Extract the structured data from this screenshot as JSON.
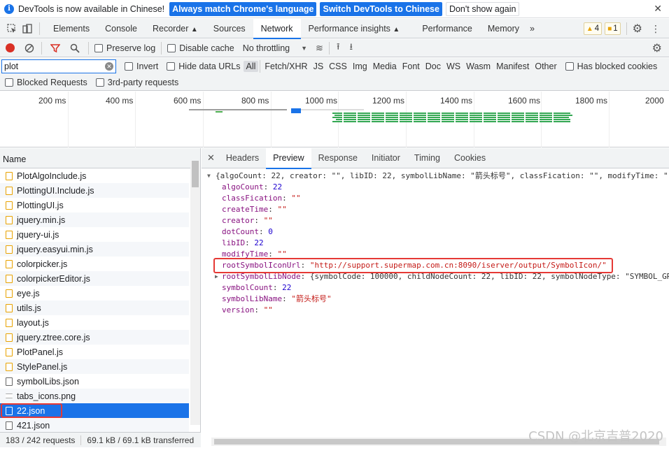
{
  "infobar": {
    "message": "DevTools is now available in Chinese!",
    "btn_match": "Always match Chrome's language",
    "btn_switch": "Switch DevTools to Chinese",
    "btn_dismiss": "Don't show again"
  },
  "main_tabs": [
    "Elements",
    "Console",
    "Recorder",
    "Sources",
    "Network",
    "Performance insights",
    "Performance",
    "Memory"
  ],
  "active_main_tab": "Network",
  "badges": {
    "warnings": "4",
    "issues": "1"
  },
  "toolbar": {
    "preserve_log": "Preserve log",
    "disable_cache": "Disable cache",
    "throttling": "No throttling"
  },
  "filter": {
    "value": "plot",
    "invert": "Invert",
    "hide_data_urls": "Hide data URLs",
    "types": [
      "All",
      "Fetch/XHR",
      "JS",
      "CSS",
      "Img",
      "Media",
      "Font",
      "Doc",
      "WS",
      "Wasm",
      "Manifest",
      "Other"
    ],
    "has_blocked_cookies": "Has blocked cookies",
    "blocked_requests": "Blocked Requests",
    "third_party": "3rd-party requests"
  },
  "timeline_ticks": [
    "200 ms",
    "400 ms",
    "600 ms",
    "800 ms",
    "1000 ms",
    "1200 ms",
    "1400 ms",
    "1600 ms",
    "1800 ms",
    "2000"
  ],
  "requests": {
    "header": "Name",
    "items": [
      "PlotAlgoInclude.js",
      "PlottingUI.Include.js",
      "PlottingUI.js",
      "jquery.min.js",
      "jquery-ui.js",
      "jquery.easyui.min.js",
      "colorpicker.js",
      "colorpickerEditor.js",
      "eye.js",
      "utils.js",
      "layout.js",
      "jquery.ztree.core.js",
      "PlotPanel.js",
      "StylePanel.js",
      "symbolLibs.json",
      "tabs_icons.png",
      "22.json",
      "421.json"
    ],
    "selected": "22.json"
  },
  "status": {
    "requests": "183 / 242 requests",
    "transferred": "69.1 kB / 69.1 kB transferred"
  },
  "detail_tabs": [
    "Headers",
    "Preview",
    "Response",
    "Initiator",
    "Timing",
    "Cookies"
  ],
  "active_detail_tab": "Preview",
  "preview": {
    "summary": "{algoCount: 22, creator: \"\", libID: 22, symbolLibName: \"箭头标号\", classFication: \"\", modifyTime: \"\"",
    "props": [
      {
        "key": "algoCount",
        "value": "22",
        "kind": "num"
      },
      {
        "key": "classFication",
        "value": "\"\"",
        "kind": "str"
      },
      {
        "key": "createTime",
        "value": "\"\"",
        "kind": "str"
      },
      {
        "key": "creator",
        "value": "\"\"",
        "kind": "str"
      },
      {
        "key": "dotCount",
        "value": "0",
        "kind": "num"
      },
      {
        "key": "libID",
        "value": "22",
        "kind": "num"
      },
      {
        "key": "modifyTime",
        "value": "\"\"",
        "kind": "str"
      },
      {
        "key": "rootSymbolIconUrl",
        "value": "\"http://support.supermap.com.cn:8090/iserver/output/SymbolIcon/\"",
        "kind": "str"
      },
      {
        "key": "rootSymbolLibNode",
        "value": "{symbolCode: 100000, childNodeCount: 22, libID: 22, symbolNodeType: \"SYMBOL_GR",
        "kind": "obj"
      },
      {
        "key": "symbolCount",
        "value": "22",
        "kind": "num"
      },
      {
        "key": "symbolLibName",
        "value": "\"箭头标号\"",
        "kind": "str"
      },
      {
        "key": "version",
        "value": "\"\"",
        "kind": "str"
      }
    ]
  },
  "watermark": "CSDN @北京吉普2020",
  "colors": {
    "accent": "#1a73e8",
    "highlight": "#e53935",
    "record": "#d93025"
  }
}
